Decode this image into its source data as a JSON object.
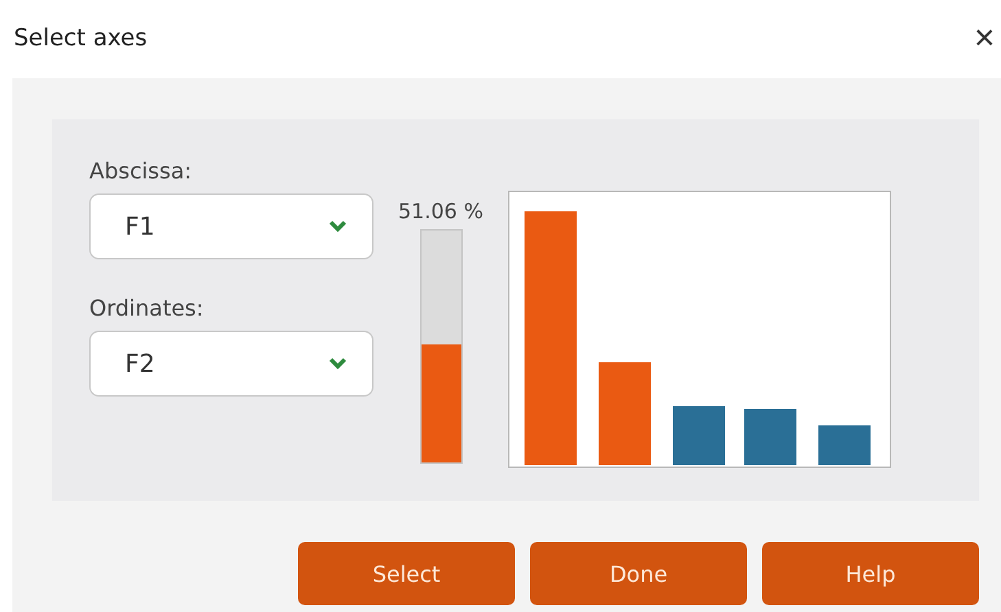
{
  "window": {
    "title": "Select axes",
    "close": "×"
  },
  "abscissa": {
    "label": "Abscissa:",
    "value": "F1"
  },
  "ordinates": {
    "label": "Ordinates:",
    "value": "F2"
  },
  "meter": {
    "reading": "51.06 %",
    "level": 0.51
  },
  "bars": [
    {
      "selected": true
    },
    {
      "selected": true
    },
    {
      "selected": false
    },
    {
      "selected": false
    },
    {
      "selected": false
    }
  ],
  "buttons": [
    "Select",
    "Done",
    "Help"
  ]
}
